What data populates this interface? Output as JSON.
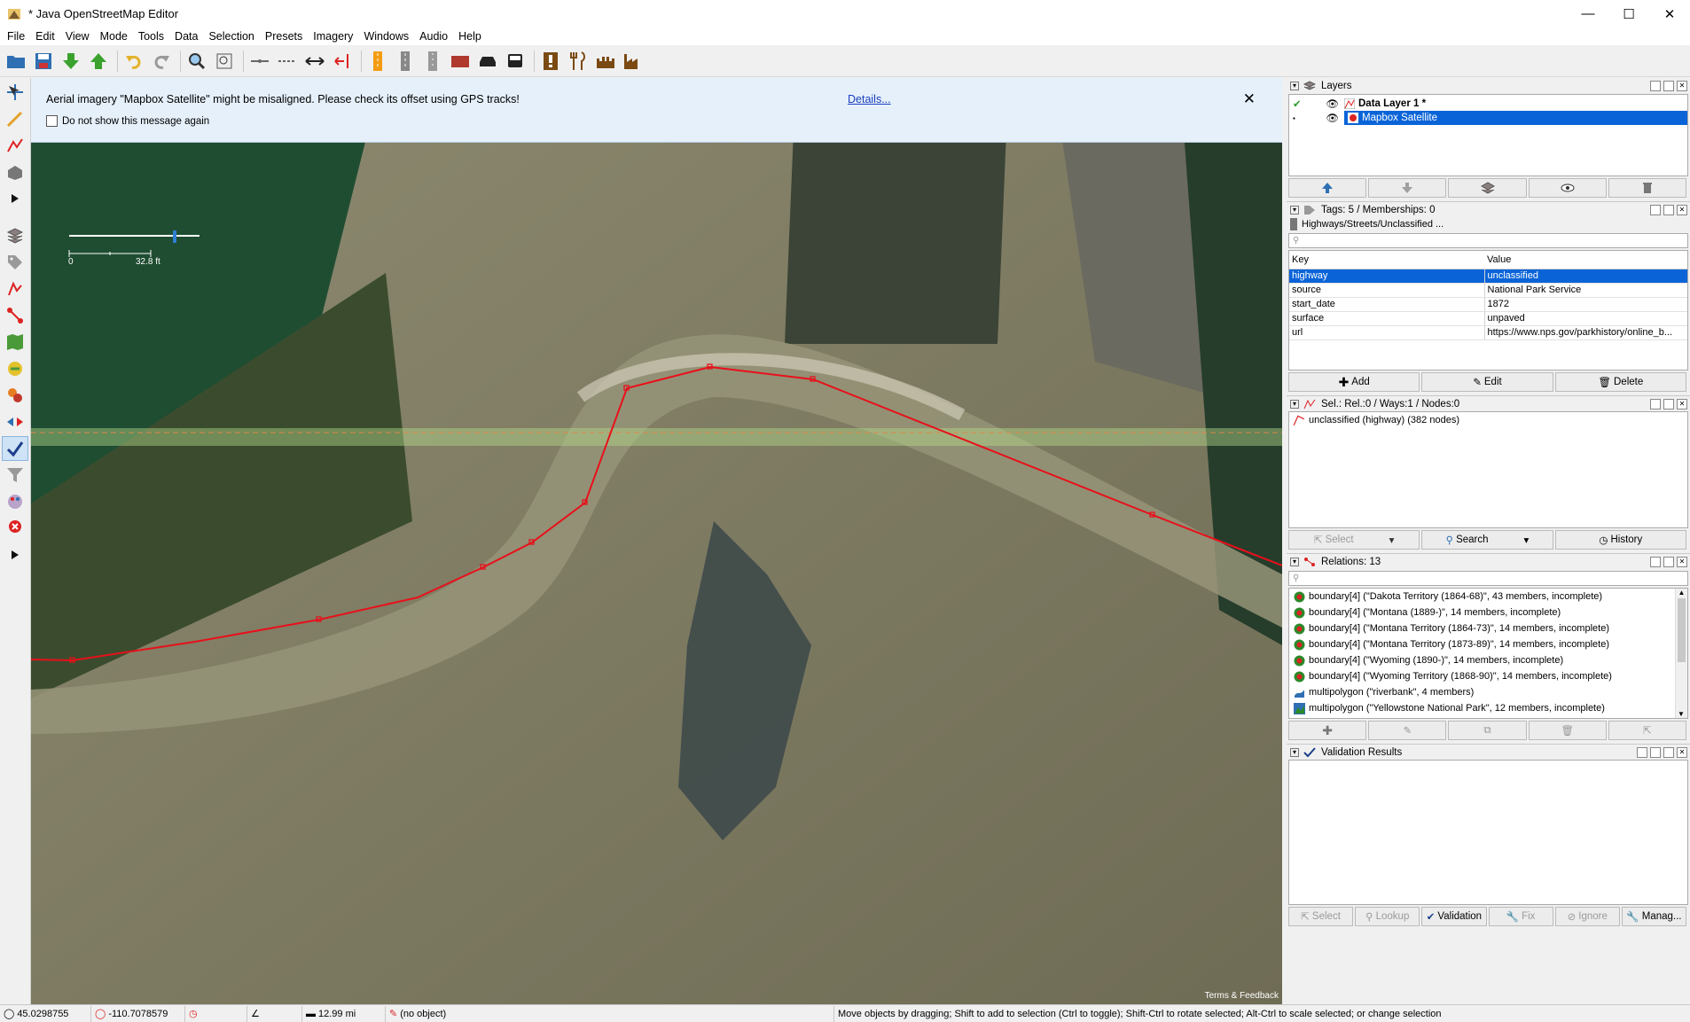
{
  "window": {
    "title": "* Java OpenStreetMap Editor"
  },
  "menu": [
    "File",
    "Edit",
    "View",
    "Mode",
    "Tools",
    "Data",
    "Selection",
    "Presets",
    "Imagery",
    "Windows",
    "Audio",
    "Help"
  ],
  "notice": {
    "message": "Aerial imagery \"Mapbox Satellite\" might be misaligned. Please check its offset using GPS tracks!",
    "checkbox_label": "Do not show this message again",
    "details_link": "Details..."
  },
  "scale": {
    "zero": "0",
    "length": "32.8 ft"
  },
  "attribution": "Terms & Feedback",
  "layers": {
    "title": "Layers",
    "items": [
      {
        "name": "Data Layer 1 *",
        "selected": false
      },
      {
        "name": "Mapbox Satellite",
        "selected": true
      }
    ]
  },
  "tags": {
    "title": "Tags: 5 / Memberships: 0",
    "preset": "Highways/Streets/Unclassified ...",
    "col_key": "Key",
    "col_value": "Value",
    "rows": [
      {
        "key": "highway",
        "value": "unclassified"
      },
      {
        "key": "source",
        "value": "National Park Service"
      },
      {
        "key": "start_date",
        "value": "1872"
      },
      {
        "key": "surface",
        "value": "unpaved"
      },
      {
        "key": "url",
        "value": "https://www.nps.gov/parkhistory/online_b..."
      }
    ],
    "add": "Add",
    "edit": "Edit",
    "delete": "Delete"
  },
  "selection": {
    "title": "Sel.: Rel.:0 / Ways:1 / Nodes:0",
    "item": "unclassified (highway) (382 nodes)",
    "select": "Select",
    "search": "Search",
    "history": "History"
  },
  "relations": {
    "title": "Relations: 13",
    "items": [
      "boundary[4] (\"Dakota Territory (1864-68)\", 43 members, incomplete)",
      "boundary[4] (\"Montana (1889-)\", 14 members, incomplete)",
      "boundary[4] (\"Montana Territory (1864-73)\", 14 members, incomplete)",
      "boundary[4] (\"Montana Territory (1873-89)\", 14 members, incomplete)",
      "boundary[4] (\"Wyoming (1890-)\", 14 members, incomplete)",
      "boundary[4] (\"Wyoming Territory (1868-90)\", 14 members, incomplete)",
      "multipolygon (\"riverbank\", 4 members)",
      "multipolygon (\"Yellowstone National Park\", 12 members, incomplete)"
    ]
  },
  "validation": {
    "title": "Validation Results",
    "buttons": [
      "Select",
      "Lookup",
      "Validation",
      "Fix",
      "Ignore",
      "Manag..."
    ]
  },
  "status": {
    "lat": "45.0298755",
    "lon": "-110.7078579",
    "distance": "12.99 mi",
    "object": "(no object)",
    "help": "Move objects by dragging; Shift to add to selection (Ctrl to toggle); Shift-Ctrl to rotate selected; Alt-Ctrl to scale selected; or change selection"
  }
}
